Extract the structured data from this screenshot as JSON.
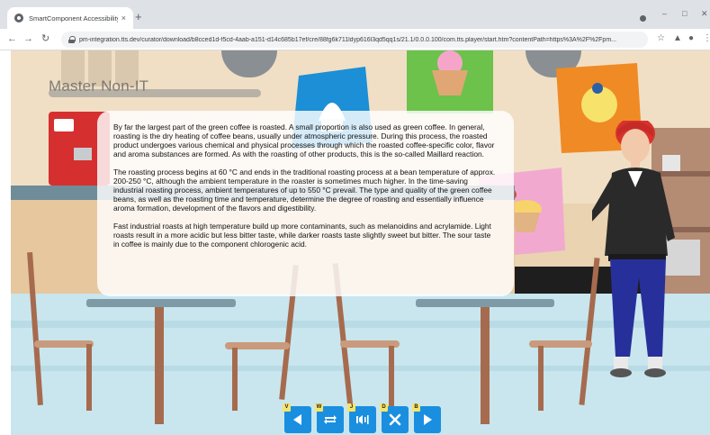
{
  "browser": {
    "tab_title": "SmartComponent Accessibility",
    "tab_close": "×",
    "new_tab": "+",
    "url": "pm-integration.tts.dev/curator/download/b8cced1d-f5cd-4aab-a151-d14c685b17ef/cre/88fg6k711ldyp616l3qd5qq1s/21.1/0.0.0.100/com.tts.player/start.htm?contentPath=https%3A%2F%2Fpm..."
  },
  "course": {
    "title": "Master Non-IT",
    "paragraphs": [
      "By far the largest part of the green coffee is roasted. A small proportion is also used as green coffee. In general, roasting is the dry heating of coffee beans, usually under atmospheric pressure. During this process, the roasted product undergoes various chemical and physical processes through which the roasted coffee-specific color, flavor and aroma substances are formed. As with the roasting of other products, this is the so-called Maillard reaction.",
      "The roasting process begins at 60 °C and ends in the traditional roasting process at a bean temperature of approx. 200-250 °C, although the ambient temperature in the roaster is sometimes much higher. In the time-saving industrial roasting process, ambient temperatures of up to 550 °C prevail. The type and quality of the green coffee beans, as well as the roasting time and temperature, determine the degree of roasting and essentially influence aroma formation, development of the flavors and digestibility.",
      "Fast industrial roasts at high temperature build up more contaminants, such as melanoidins and acrylamide. Light roasts result in a more acidic but less bitter taste, while darker roasts taste slightly sweet but bitter. The sour taste in coffee is mainly due to the component chlorogenic acid."
    ]
  },
  "controls": {
    "previous": {
      "key": "V",
      "icon": "arrow-left-icon"
    },
    "replay": {
      "key": "W",
      "icon": "replay-icon"
    },
    "audio": {
      "key": "J",
      "icon": "audio-icon"
    },
    "close": {
      "key": "D",
      "icon": "close-icon"
    },
    "next": {
      "key": "B",
      "icon": "arrow-right-icon"
    }
  },
  "colors": {
    "control_blue": "#1a8fe0",
    "key_badge": "#f7e46b"
  }
}
